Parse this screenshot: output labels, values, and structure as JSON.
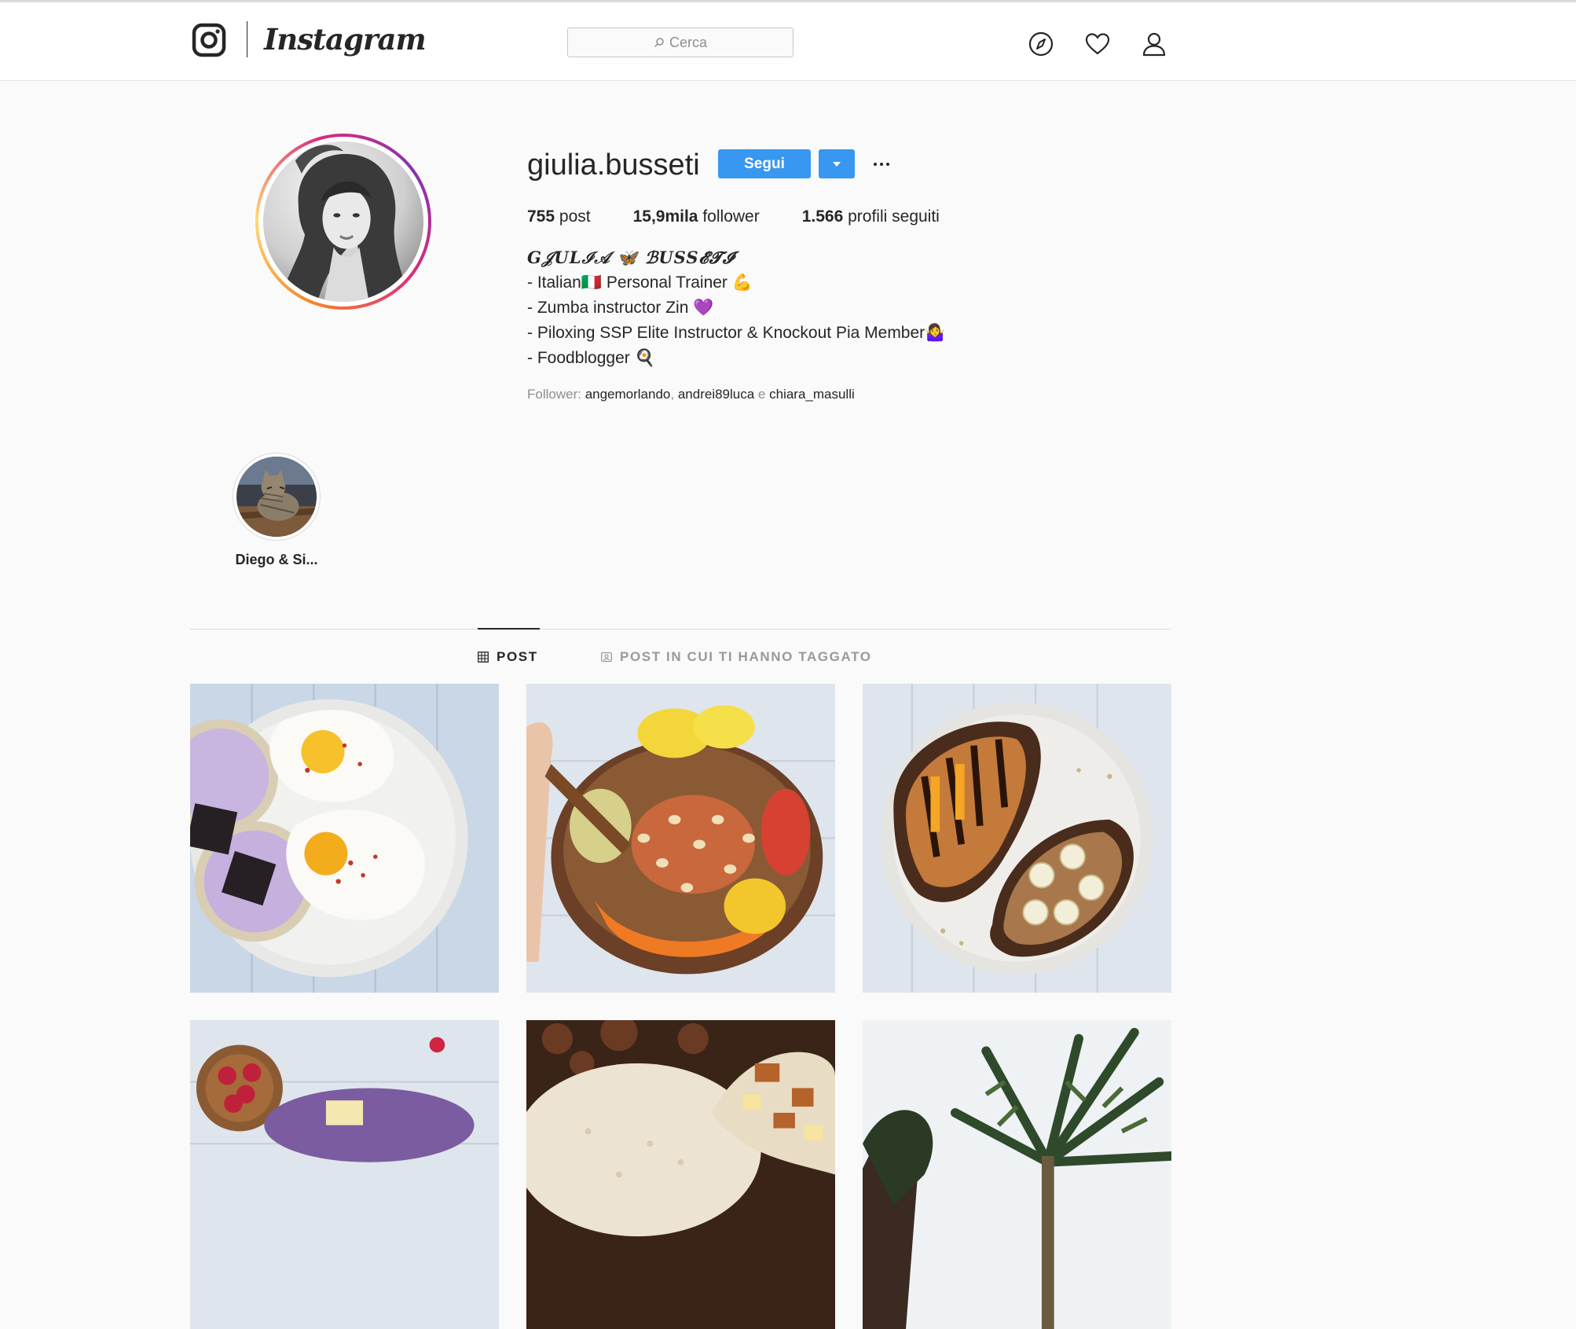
{
  "header": {
    "logo_text": "Instagram",
    "search": {
      "placeholder": "Cerca"
    },
    "nav": [
      "compass-icon",
      "heart-icon",
      "user-icon"
    ]
  },
  "profile": {
    "username": "giulia.busseti",
    "follow_label": "Segui",
    "stats": [
      {
        "value": "755",
        "label": "post"
      },
      {
        "value": "15,9mila",
        "label": "follower"
      },
      {
        "value": "1.566",
        "label": "profili seguiti"
      }
    ],
    "bio": {
      "name": "G𝒥ULℐ𝒜 🦋 ℬUSS𝓔𝓣𝓘",
      "lines": [
        "- Italian🇮🇹 Personal Trainer 💪",
        "- Zumba instructor Zin 💜",
        "- Piloxing SSP Elite Instructor & Knockout Pia Member🤷‍♀️",
        "- Foodblogger 🍳"
      ]
    },
    "followed_by": {
      "prefix": "Follower: ",
      "users": [
        "angemorlando",
        "andrei89luca",
        "chiara_masulli"
      ],
      "separator": ", ",
      "conjunction": " e "
    }
  },
  "highlights": [
    {
      "label": "Diego & Si..."
    }
  ],
  "tabs": [
    {
      "label": "POST",
      "active": true,
      "icon": "grid-icon"
    },
    {
      "label": "POST IN CUI TI HANNO TAGGATO",
      "active": false,
      "icon": "tag-icon"
    }
  ],
  "colors": {
    "accent": "#3897f0",
    "text": "#262626",
    "muted": "#8e8e8e",
    "border": "#dbdbdb",
    "background": "#fafafa"
  }
}
